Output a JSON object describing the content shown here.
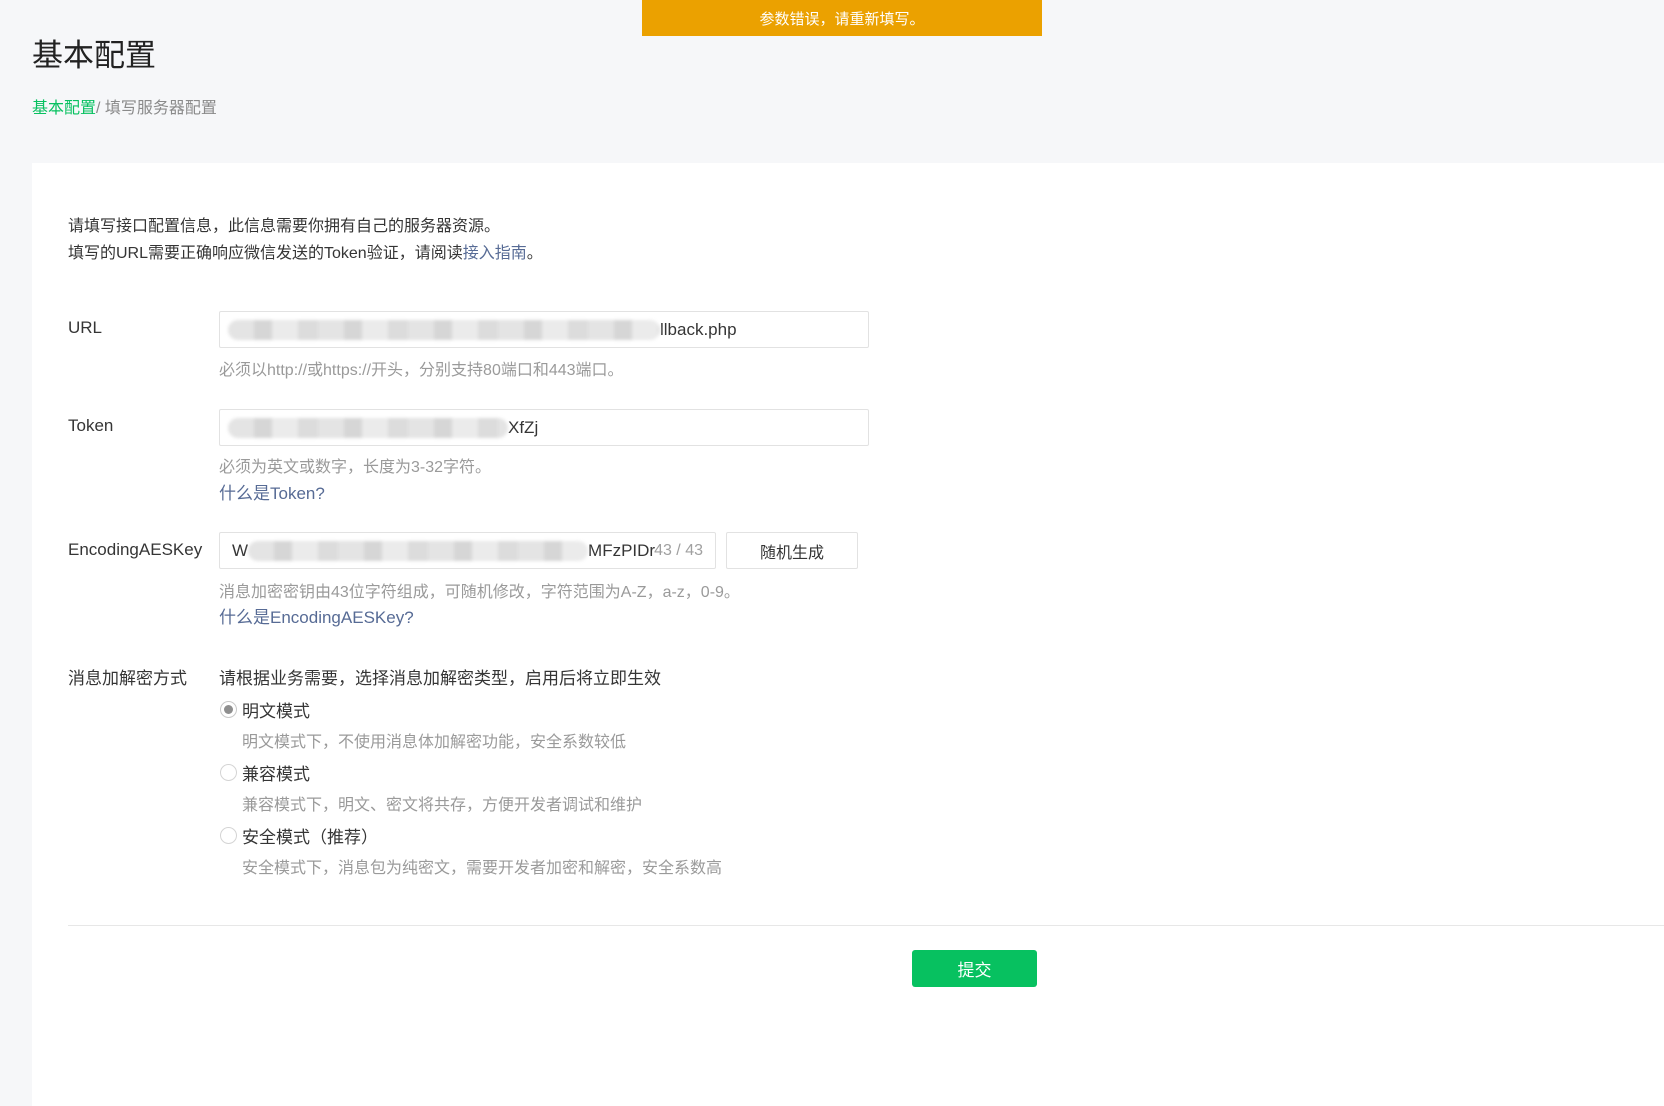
{
  "toast": {
    "message": "参数错误，请重新填写。"
  },
  "page": {
    "title": "基本配置"
  },
  "breadcrumb": {
    "link": "基本配置",
    "separator": "/ ",
    "current": "填写服务器配置"
  },
  "intro": {
    "line1": "请填写接口配置信息，此信息需要你拥有自己的服务器资源。",
    "line2_prefix": "填写的URL需要正确响应微信发送的Token验证，请阅读",
    "line2_link": "接入指南",
    "line2_suffix": "。"
  },
  "url": {
    "label": "URL",
    "value_visible": "llback.php",
    "hint": "必须以http://或https://开头，分别支持80端口和443端口。"
  },
  "token": {
    "label": "Token",
    "value_visible": "XfZj",
    "hint": "必须为英文或数字，长度为3-32字符。",
    "help_link": "什么是Token?"
  },
  "aes": {
    "label": "EncodingAESKey",
    "value_prefix": "W",
    "value_visible": "MFzPIDr",
    "counter": "43 / 43",
    "random_button": "随机生成",
    "hint": "消息加密密钥由43位字符组成，可随机修改，字符范围为A-Z，a-z，0-9。",
    "help_link": "什么是EncodingAESKey?"
  },
  "mode": {
    "label": "消息加解密方式",
    "description": "请根据业务需要，选择消息加解密类型，启用后将立即生效",
    "options": [
      {
        "label": "明文模式",
        "desc": "明文模式下，不使用消息体加解密功能，安全系数较低",
        "checked": true
      },
      {
        "label": "兼容模式",
        "desc": "兼容模式下，明文、密文将共存，方便开发者调试和维护",
        "checked": false
      },
      {
        "label": "安全模式（推荐）",
        "desc": "安全模式下，消息包为纯密文，需要开发者加密和解密，安全系数高",
        "checked": false
      }
    ]
  },
  "submit": {
    "label": "提交"
  },
  "colors": {
    "accent": "#07c160",
    "toast": "#eba100",
    "link": "#576b95"
  }
}
